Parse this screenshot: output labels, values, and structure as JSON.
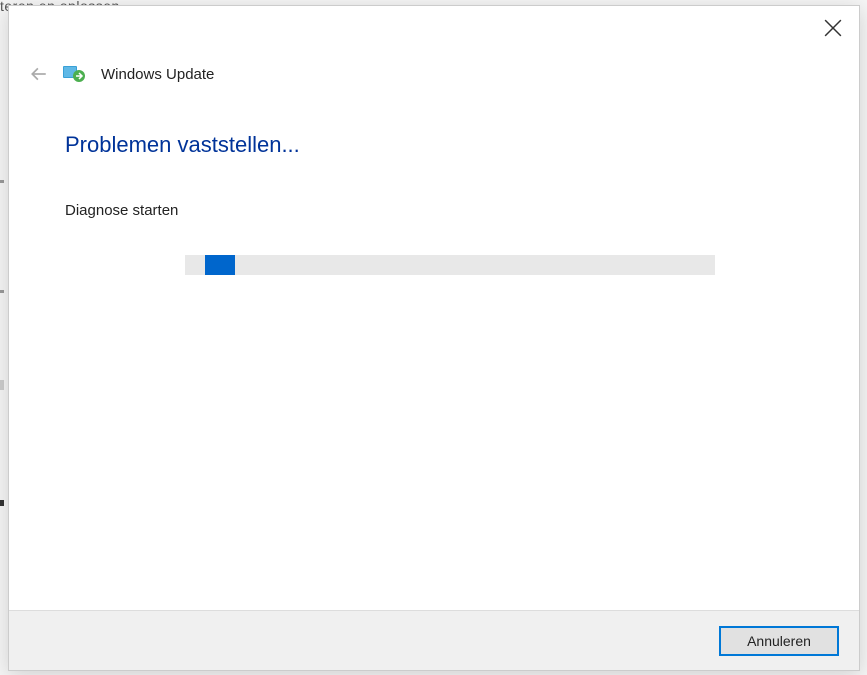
{
  "background": {
    "partial_text": "teren en oplossen"
  },
  "dialog": {
    "app_title": "Windows Update",
    "heading": "Problemen vaststellen...",
    "status": "Diagnose starten",
    "cancel_label": "Annuleren",
    "progress": {
      "offset_percent": 4,
      "fill_percent": 6
    }
  }
}
